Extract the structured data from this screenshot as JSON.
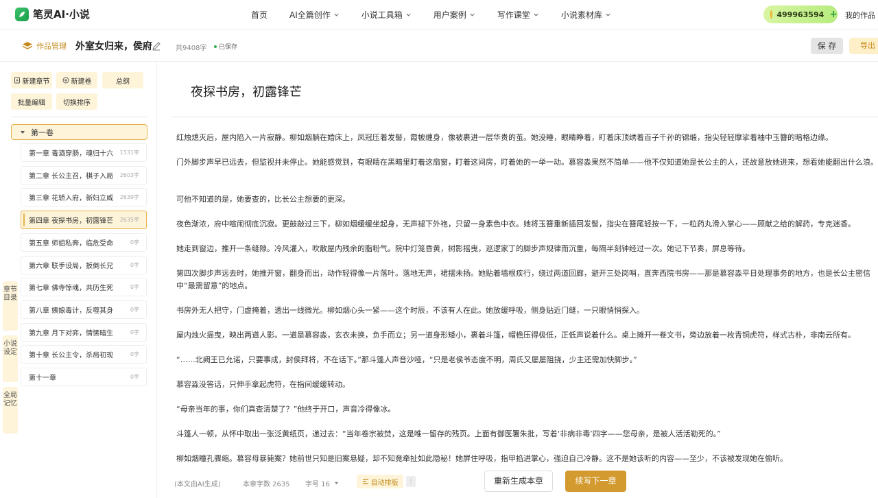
{
  "app": {
    "logo_text": "笔灵AI·小说",
    "nav": [
      {
        "label": "首页",
        "has_menu": false
      },
      {
        "label": "AI全篇创作",
        "has_menu": true
      },
      {
        "label": "小说工具箱",
        "has_menu": true
      },
      {
        "label": "用户案例",
        "has_menu": true
      },
      {
        "label": "写作课堂",
        "has_menu": true
      },
      {
        "label": "小说素材库",
        "has_menu": true
      }
    ],
    "points": "499963594",
    "points_plus": "+",
    "my_works": "我的作品"
  },
  "subheader": {
    "works_manage": "作品管理",
    "work_title": "外室女归来，侯府掉马甲",
    "word_count": "共9408字",
    "saved_status": "已保存",
    "save_label": "保 存",
    "export_label": "导出"
  },
  "sidebar": {
    "toolbar": {
      "new_chapter": "新建章节",
      "new_volume": "新建卷",
      "outline": "总纲",
      "batch_edit": "批量编辑",
      "toggle_sort": "切换排序"
    },
    "volume": "第一卷",
    "chapters": [
      {
        "title": "第一章 毒酒穿肠，魂归十六",
        "count": "1531字"
      },
      {
        "title": "第二章 长公主召，棋子入局",
        "count": "2603字"
      },
      {
        "title": "第三章 花轿入府，新妇立威",
        "count": "2639字"
      },
      {
        "title": "第四章 夜探书房，初露锋芒",
        "count": "2635字",
        "active": true
      },
      {
        "title": "第五章 师姐私奔，临危受命",
        "count": "0字"
      },
      {
        "title": "第六章 联手设局，扳倒长兄",
        "count": "0字"
      },
      {
        "title": "第七章 佛寺惊魂，共历生死",
        "count": "0字"
      },
      {
        "title": "第八章 姨娘毒计，反噬其身",
        "count": "0字"
      },
      {
        "title": "第九章 月下对弈，情愫暗生",
        "count": "0字"
      },
      {
        "title": "第十章 长公主令，杀局初现",
        "count": "0字"
      },
      {
        "title": "第十一章",
        "count": "0字"
      }
    ],
    "vertical_tabs": [
      "章节目录",
      "小说设定",
      "全局记忆"
    ]
  },
  "editor": {
    "chapter_title": "夜探书房，初露锋芒",
    "paragraphs": [
      "红烛熄灭后，屋内陷入一片寂静。柳如烟躺在婚床上，凤冠压着发髻，霞帔缠身，像被裹进一层华贵的茧。她没睡，眼睛睁着，盯着床顶绣着百子千孙的锦缎，指尖轻轻摩挲着袖中玉簪的暗格边缘。",
      "门外脚步声早已远去，但监视并未停止。她能感觉到，有眼睛在黑暗里盯着这扇窗，盯着这间房，盯着她的一举一动。慕容淼果然不简单——他不仅知道她是长公主的人，还故意放她进来，想看她能翻出什么浪。",
      "可他不知道的是，她要查的，比长公主想要的更深。",
      "夜色渐浓，府中喧闹彻底沉寂。更鼓敲过三下，柳如烟缓缓坐起身，无声褪下外袍，只留一身素色中衣。她将玉簪重新插回发髻，指尖在簪尾轻按一下，一粒药丸滑入掌心——顾献之给的解药，专克迷香。",
      "她走到窗边，推开一条缝隙。冷风灌入，吹散屋内残余的脂粉气。院中灯笼昏黄，树影摇曳，巡逻家丁的脚步声规律而沉重，每隔半刻钟经过一次。她记下节奏，屏息等待。",
      "第四次脚步声远去时，她推开窗，翻身而出，动作轻得像一片落叶。落地无声，裙摆未扬。她贴着墙根疾行，绕过两道回廊，避开三处岗哨，直奔西院书房——那是慕容淼平日处理事务的地方，也是长公主密信中“最需留意”的地点。",
      "书房外无人把守，门虚掩着，透出一线微光。柳如烟心头一紧——这个时辰，不该有人在此。她放缓呼吸，侧身贴近门缝，一只眼悄悄探入。",
      "屋内烛火摇曳，映出两道人影。一道是慕容淼，玄衣未换，负手而立；另一道身形矮小，裹着斗篷，帽檐压得极低，正低声说着什么。桌上摊开一卷文书，旁边放着一枚青铜虎符，样式古朴，非南云所有。",
      "“……北阙王已允诺，只要事成，封侯拜将，不在话下。”那斗篷人声音沙哑，“只是老侯爷态度不明，周氏又屡屡阻挠，少主还需加快脚步。”",
      "慕容淼没答话，只伸手拿起虎符，在指间缓缓转动。",
      "“母亲当年的事，你们真查清楚了？”他终于开口，声音冷得像冰。",
      "斗篷人一顿，从怀中取出一张泛黄纸页，递过去：“当年卷宗被焚，这是唯一留存的残页。上面有御医署朱批，写着‘非病非毒’四字——您母亲，是被人活活勒死的。”",
      "柳如烟瞳孔骤缩。慕容母暴毙案？她前世只知是旧案悬疑，却不知竟牵扯如此隐秘！她屏住呼吸，指甲掐进掌心，强迫自己冷静。这不是她该听的内容——至少，不该被发现她在偷听。"
    ],
    "footer": {
      "ai_note": "(本文由AI生成)",
      "chapter_count": "本章字数 2635",
      "font_size": "字号 16",
      "auto_layout": "自动排版",
      "more": "⋮",
      "regenerate": "重新生成本章",
      "continue": "续写下一章"
    }
  }
}
